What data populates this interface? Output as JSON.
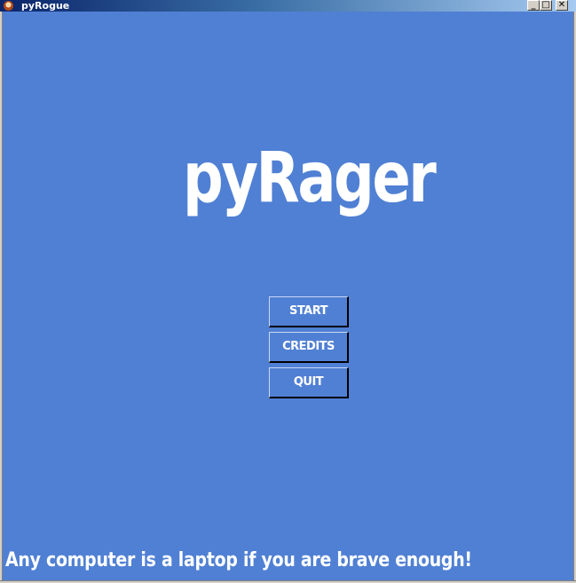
{
  "window": {
    "title": "pyRogue",
    "controls": {
      "minimize": "_",
      "maximize": "□",
      "close": "✕"
    },
    "icon": "game-app-icon"
  },
  "game": {
    "title": "pyRager",
    "menu": {
      "start_label": "START",
      "credits_label": "CREDITS",
      "quit_label": "QUIT"
    },
    "tagline": "Any computer is a laptop if you are brave enough!"
  },
  "colors": {
    "background": "#5080d4",
    "text": "#ffffff",
    "button_shadow": "#000000",
    "titlebar_start": "#0a246a",
    "titlebar_end": "#a6caf0"
  }
}
